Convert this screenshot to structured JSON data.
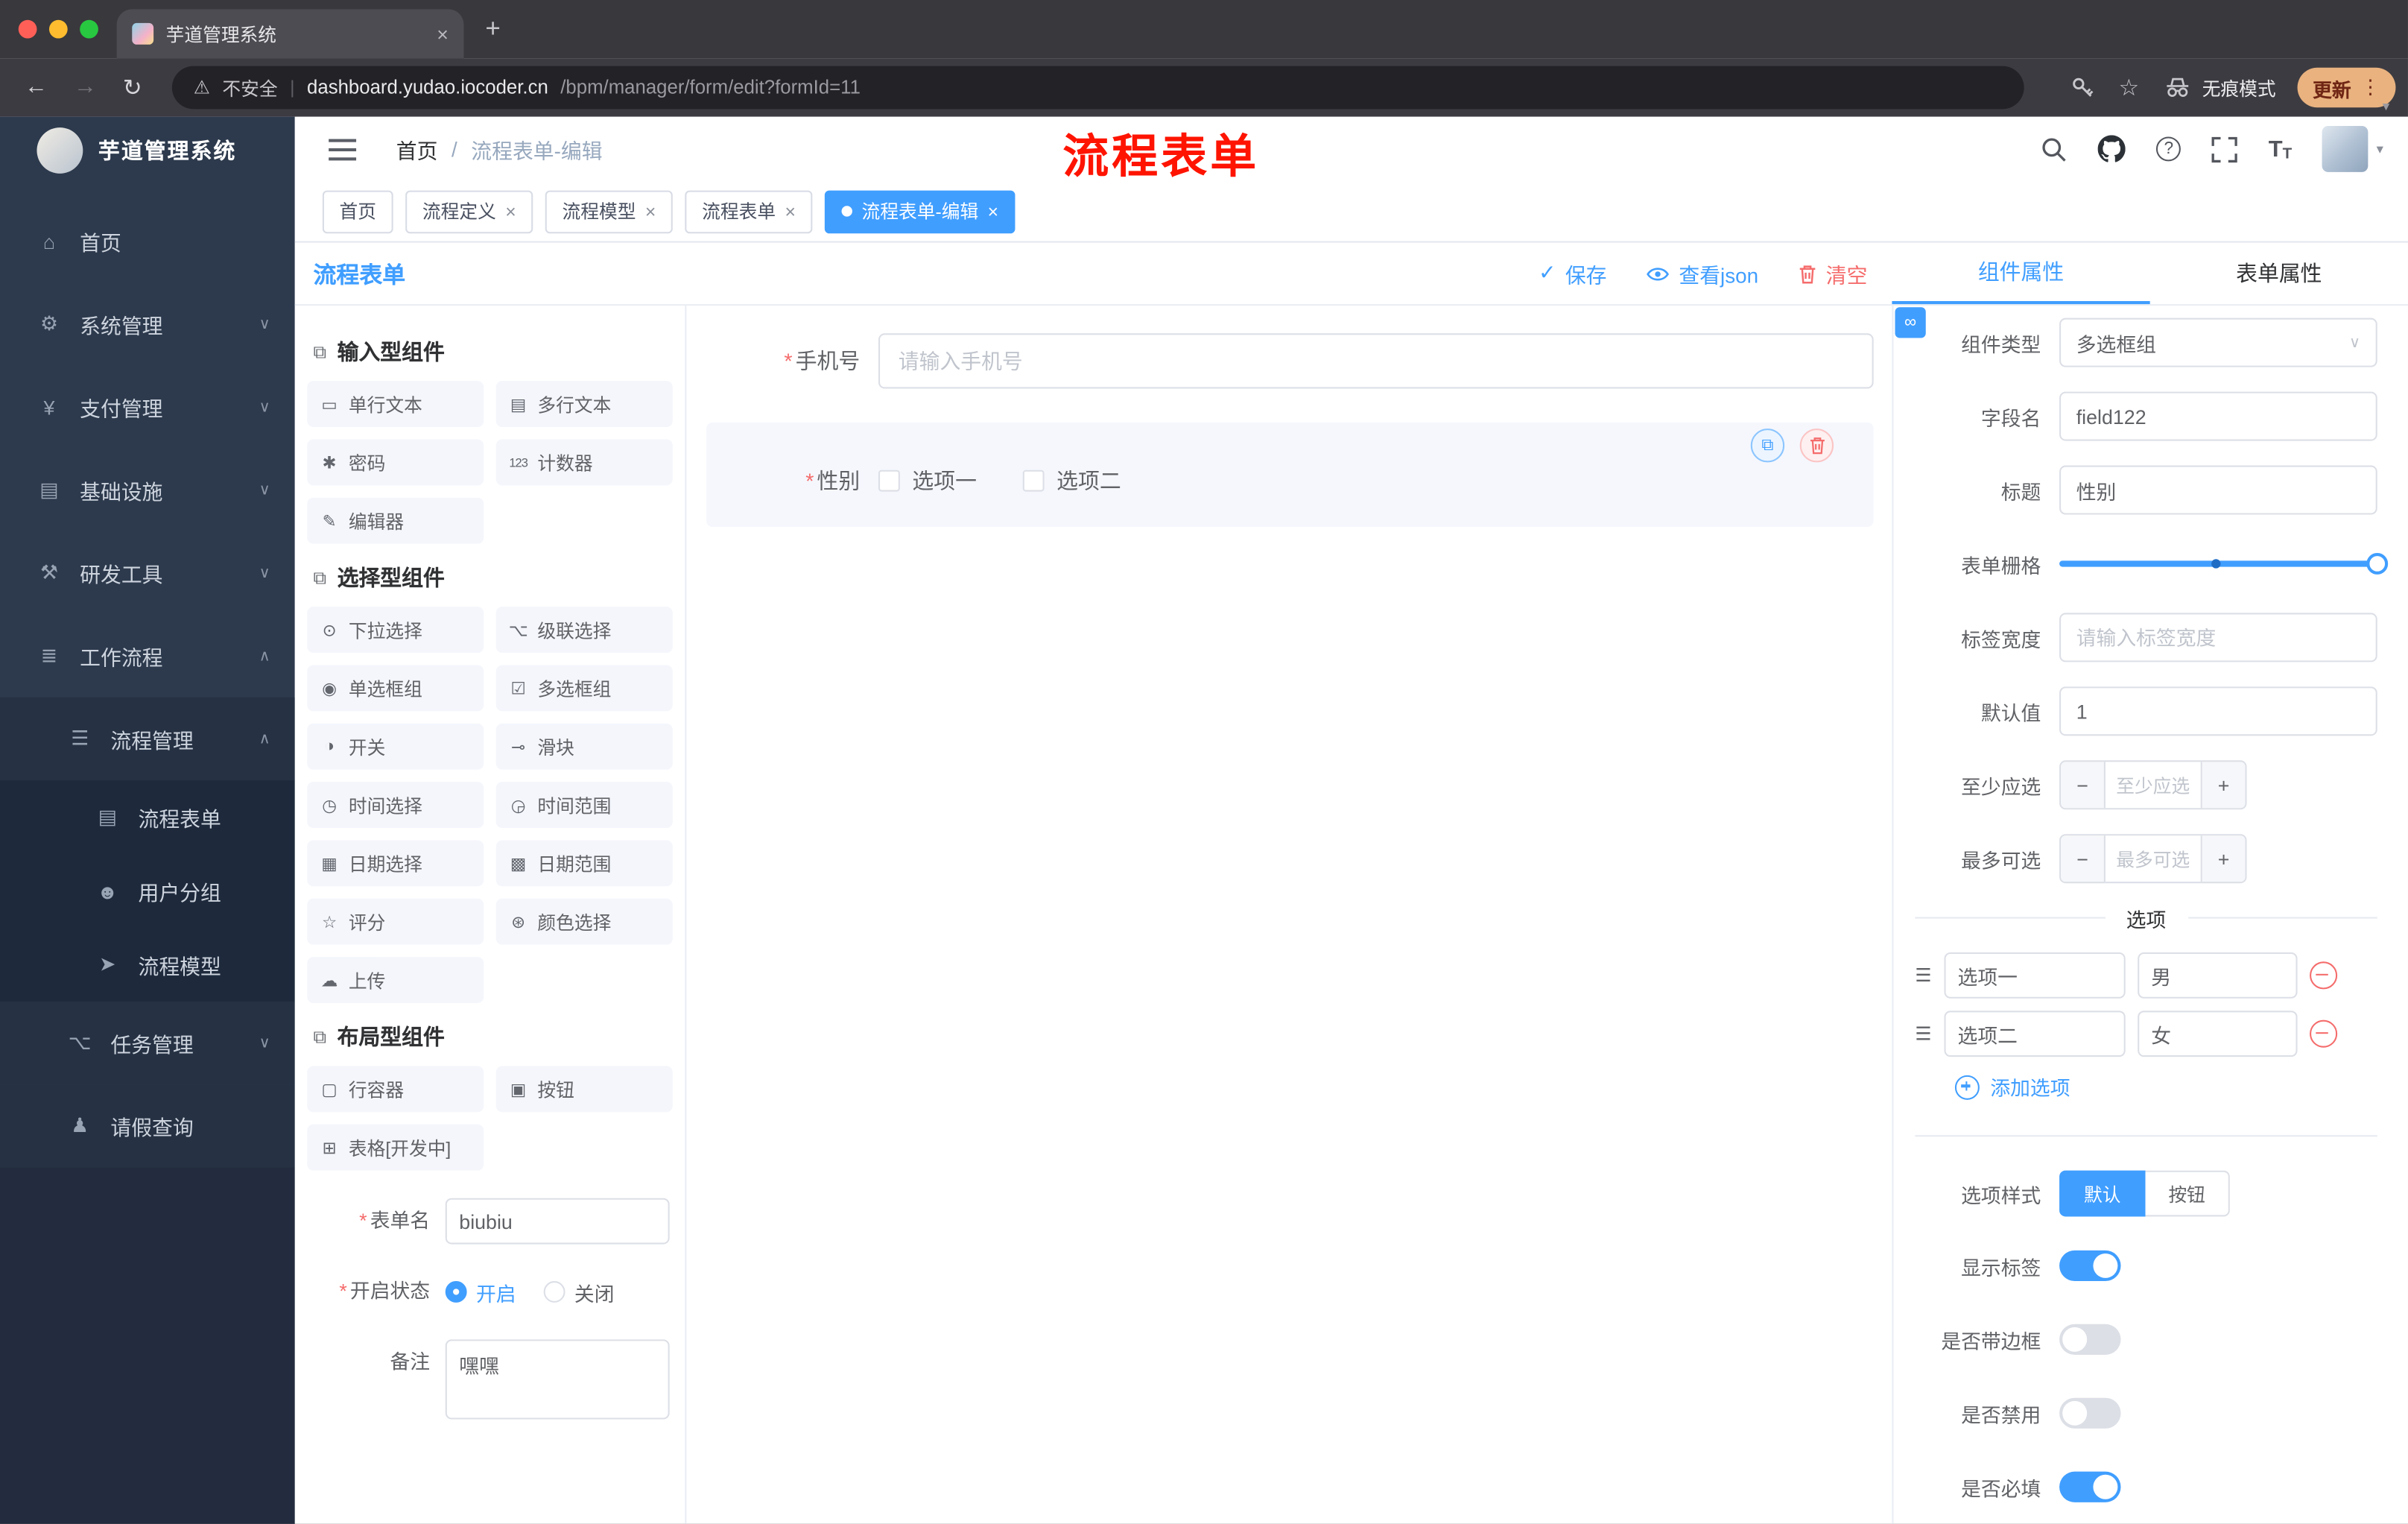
{
  "icons": {
    "close": "×",
    "plus": "+",
    "dots": "⋮",
    "back": "←",
    "forward": "→",
    "reload": "↻",
    "warning": "⚠",
    "star": "☆",
    "pipe": "|",
    "caret": "▾",
    "chevron_down": "∨",
    "chevron_up": "∧",
    "sep": "/",
    "check": "✓",
    "copy": "⧉",
    "section": "⧉",
    "link": "∞",
    "drag": "☰",
    "asterisk": "*",
    "question": "?",
    "font_big": "T",
    "font_small": "T",
    "minus": "−"
  },
  "browser": {
    "tab_title": "芋道管理系统",
    "security": "不安全",
    "domain": "dashboard.yudao.iocoder.cn",
    "path": "/bpm/manager/form/edit?formId=11",
    "incognito": "无痕模式",
    "update": "更新"
  },
  "annotation": "流程表单",
  "sidebar": {
    "brand": "芋道管理系统",
    "items": [
      {
        "icon": "⌂",
        "label": "首页",
        "chevron": ""
      },
      {
        "icon": "⚙",
        "label": "系统管理",
        "chevron": "∨"
      },
      {
        "icon": "¥",
        "label": "支付管理",
        "chevron": "∨"
      },
      {
        "icon": "▤",
        "label": "基础设施",
        "chevron": "∨"
      },
      {
        "icon": "⚒",
        "label": "研发工具",
        "chevron": "∨"
      },
      {
        "icon": "≣",
        "label": "工作流程",
        "chevron": "∧"
      },
      {
        "icon": "☰",
        "label": "流程管理",
        "chevron": "∧"
      },
      {
        "icon": "▤",
        "label": "流程表单",
        "chevron": ""
      },
      {
        "icon": "☻",
        "label": "用户分组",
        "chevron": ""
      },
      {
        "icon": "➤",
        "label": "流程模型",
        "chevron": ""
      },
      {
        "icon": "⌥",
        "label": "任务管理",
        "chevron": "∨"
      },
      {
        "icon": "♟",
        "label": "请假查询",
        "chevron": ""
      }
    ]
  },
  "header": {
    "breadcrumb_home": "首页",
    "breadcrumb_current": "流程表单-编辑"
  },
  "tags": [
    {
      "label": "首页"
    },
    {
      "label": "流程定义"
    },
    {
      "label": "流程模型"
    },
    {
      "label": "流程表单"
    },
    {
      "label": "流程表单-编辑"
    }
  ],
  "designer": {
    "title": "流程表单",
    "save": "保存",
    "view_json": "查看json",
    "clear": "清空",
    "sections": [
      {
        "title": "输入型组件",
        "items": [
          {
            "icon": "▭",
            "label": "单行文本"
          },
          {
            "icon": "▤",
            "label": "多行文本"
          },
          {
            "icon": "✱",
            "label": "密码"
          },
          {
            "icon": "123",
            "label": "计数器"
          },
          {
            "icon": "✎",
            "label": "编辑器"
          }
        ]
      },
      {
        "title": "选择型组件",
        "items": [
          {
            "icon": "⊙",
            "label": "下拉选择"
          },
          {
            "icon": "⌥",
            "label": "级联选择"
          },
          {
            "icon": "◉",
            "label": "单选框组"
          },
          {
            "icon": "☑",
            "label": "多选框组"
          },
          {
            "icon": "◑",
            "label": "开关"
          },
          {
            "icon": "⊸",
            "label": "滑块"
          },
          {
            "icon": "◷",
            "label": "时间选择"
          },
          {
            "icon": "◶",
            "label": "时间范围"
          },
          {
            "icon": "▦",
            "label": "日期选择"
          },
          {
            "icon": "▩",
            "label": "日期范围"
          },
          {
            "icon": "☆",
            "label": "评分"
          },
          {
            "icon": "⊛",
            "label": "颜色选择"
          },
          {
            "icon": "☁",
            "label": "上传"
          }
        ]
      },
      {
        "title": "布局型组件",
        "items": [
          {
            "icon": "▢",
            "label": "行容器"
          },
          {
            "icon": "▣",
            "label": "按钮"
          },
          {
            "icon": "⊞",
            "label": "表格[开发中]"
          }
        ]
      }
    ],
    "meta": {
      "form_name_label": "表单名",
      "form_name_value": "biubiu",
      "status_label": "开启状态",
      "status_on": "开启",
      "status_off": "关闭",
      "remark_label": "备注",
      "remark_value": "嘿嘿"
    },
    "canvas": {
      "phone_label": "手机号",
      "phone_placeholder": "请输入手机号",
      "gender_label": "性别",
      "opt1": "选项一",
      "opt2": "选项二"
    }
  },
  "inspector": {
    "tab_component": "组件属性",
    "tab_form": "表单属性",
    "type_label": "组件类型",
    "type_value": "多选框组",
    "field_label": "字段名",
    "field_value": "field122",
    "title_label": "标题",
    "title_value": "性别",
    "grid_label": "表单栅格",
    "width_label": "标签宽度",
    "width_placeholder": "请输入标签宽度",
    "default_label": "默认值",
    "default_value": "1",
    "min_label": "至少应选",
    "min_placeholder": "至少应选",
    "max_label": "最多可选",
    "max_placeholder": "最多可选",
    "options_title": "选项",
    "options": [
      {
        "label": "选项一",
        "value": "男"
      },
      {
        "label": "选项二",
        "value": "女"
      }
    ],
    "add_option": "添加选项",
    "style_label": "选项样式",
    "style_default": "默认",
    "style_button": "按钮",
    "toggles": [
      {
        "label": "显示标签"
      },
      {
        "label": "是否带边框"
      },
      {
        "label": "是否禁用"
      },
      {
        "label": "是否必填"
      }
    ]
  }
}
